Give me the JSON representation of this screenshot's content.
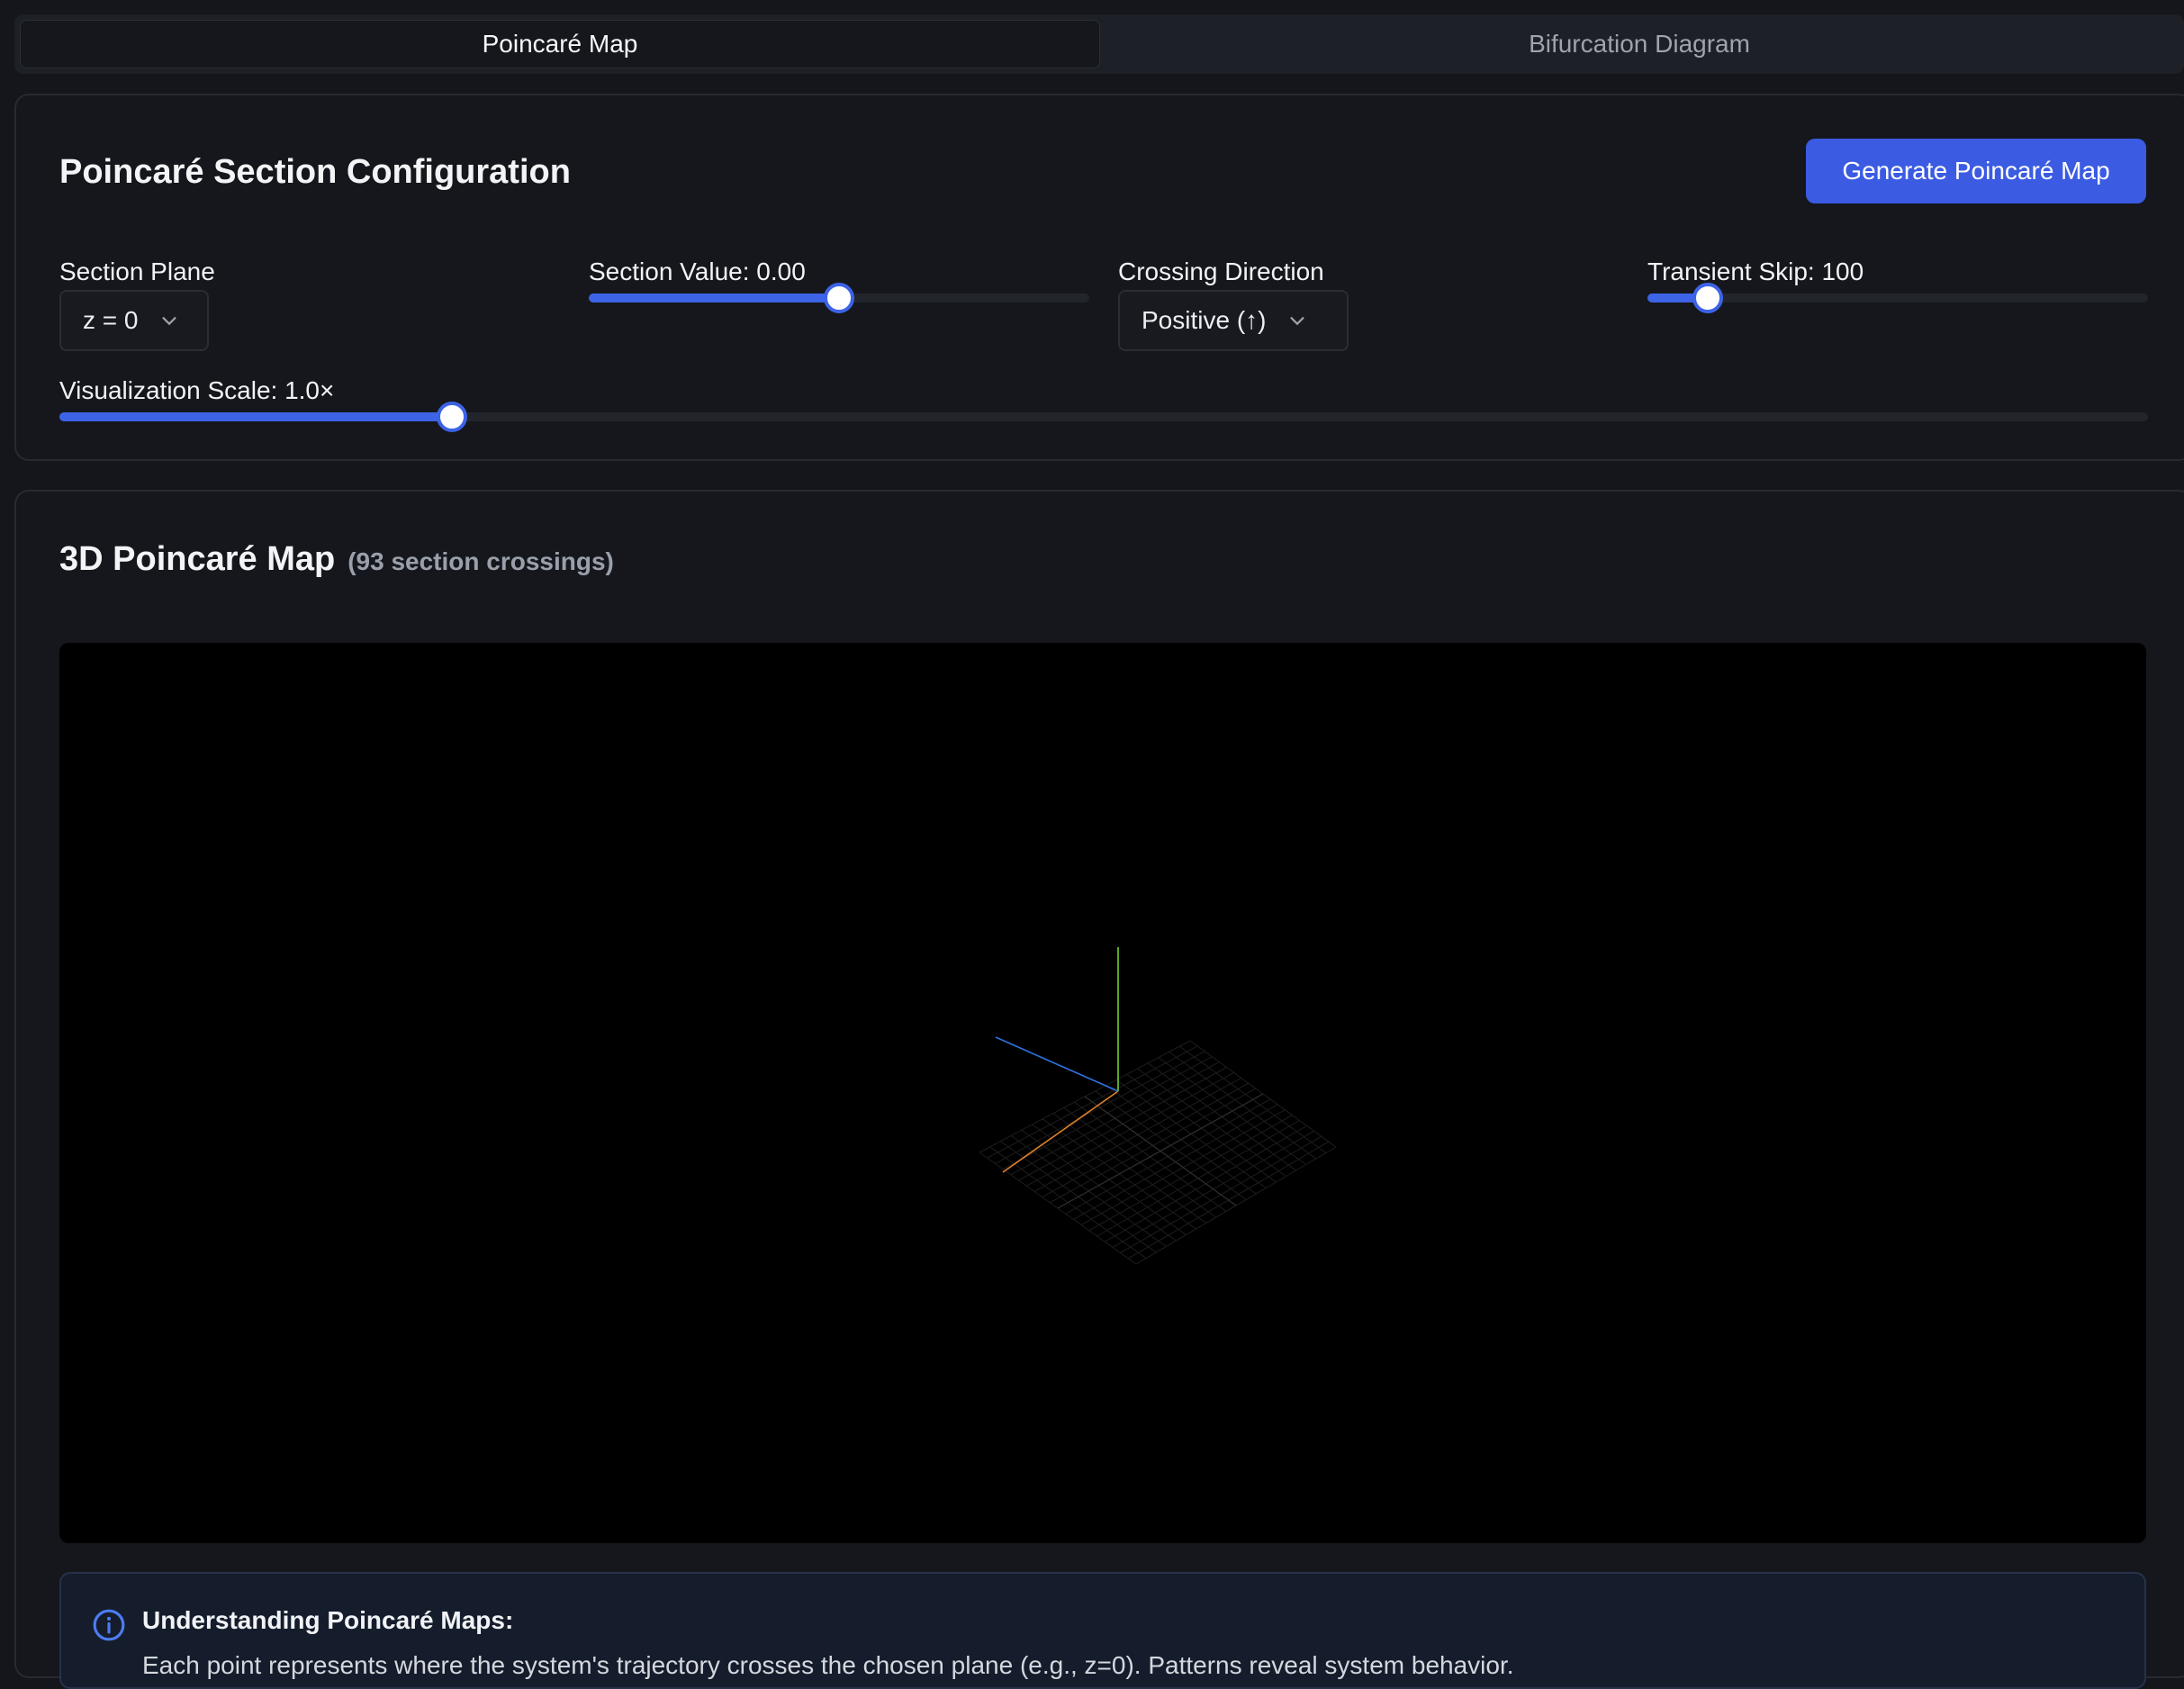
{
  "tabs": [
    {
      "label": "Poincaré Map",
      "active": true
    },
    {
      "label": "Bifurcation Diagram",
      "active": false
    }
  ],
  "config": {
    "title": "Poincaré Section Configuration",
    "generate_label": "Generate Poincaré Map",
    "section_plane": {
      "label": "Section Plane",
      "value": "z = 0",
      "icon": "chevron-down-icon"
    },
    "section_value": {
      "label": "Section Value: 0.00",
      "fraction": 0.5
    },
    "crossing_direction": {
      "label": "Crossing Direction",
      "value": "Positive (↑)",
      "icon": "chevron-down-icon"
    },
    "transient_skip": {
      "label": "Transient Skip: 100",
      "fraction": 0.12
    },
    "visualization_scale": {
      "label": "Visualization Scale: 1.0×",
      "fraction": 0.188
    }
  },
  "viz": {
    "title": "3D Poincaré Map",
    "count_label": "(93 section crossings)"
  },
  "info": {
    "icon": "info-icon",
    "title": "Understanding Poincaré Maps:",
    "text": "Each point represents where the system's trajectory crosses the chosen plane (e.g., z=0). Patterns reveal system behavior."
  },
  "colors": {
    "accent": "#3d63e6",
    "button": "#3b5be3",
    "axis_x": "#e0812b",
    "axis_y": "#6fd12f",
    "axis_z": "#2f73e0"
  }
}
